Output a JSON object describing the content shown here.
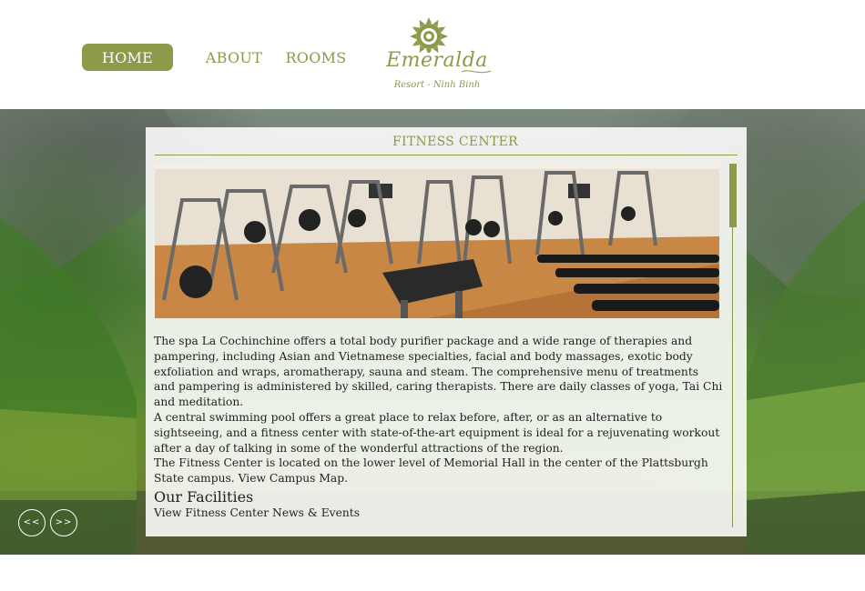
{
  "nav": {
    "home": "HOME",
    "about": "ABOUT",
    "rooms": "ROOMS"
  },
  "logo": {
    "name": "Emeralda",
    "subtitle": "Resort - Ninh Binh"
  },
  "panel": {
    "title": "FITNESS CENTER",
    "paragraphs": [
      "The spa La Cochinchine offers a total body purifier package and a wide range of therapies and pampering, including Asian and Vietnamese specialties, facial and body massages, exotic body exfoliation and wraps, aromatherapy, sauna and steam. The comprehensive menu of treatments and pampering is administered by skilled, caring therapists. There are daily classes of yoga, Tai Chi and meditation.",
      "A central swimming pool offers a great place to relax before, after, or as an alternative to sightseeing, and a fitness center with state-of-the-art equipment is ideal for a rejuvenating workout after a day of talking in some of the wonderful attractions of the region.",
      "The Fitness Center is located on the lower level of Memorial Hall in the center of the Plattsburgh State campus. View Campus Map."
    ],
    "facilities_heading": "Our Facilities",
    "facilities_link": "View Fitness Center News & Events"
  },
  "slider": {
    "prev": "<<",
    "next": ">>"
  },
  "colors": {
    "accent": "#8c9a4a",
    "panel_bg": "#ffffff",
    "text": "#222222"
  },
  "icons": {
    "logo": "sun-flower-icon",
    "swirl": "swirl-icon"
  }
}
